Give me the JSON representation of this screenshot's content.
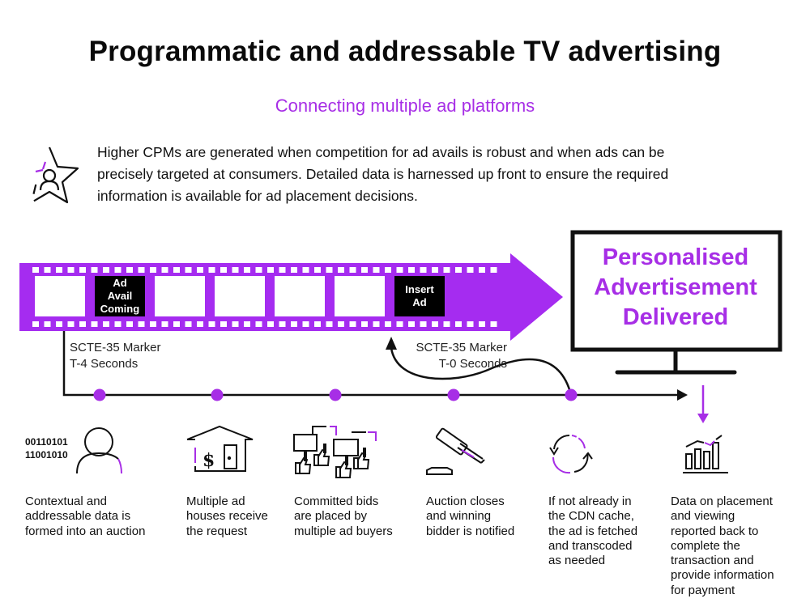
{
  "header": {
    "title": "Programmatic and addressable TV advertising",
    "subtitle": "Connecting multiple ad platforms"
  },
  "intro": {
    "icon": "star-user-icon",
    "text": "Higher CPMs are generated when competition for ad avails is robust and when ads can be precisely targeted at consumers.  Detailed data is harnessed up front to ensure the required information is available for ad placement decisions."
  },
  "filmstrip": {
    "frames": [
      {
        "label": "",
        "type": "blank"
      },
      {
        "label": "Ad\nAvail\nComing",
        "type": "marker"
      },
      {
        "label": "",
        "type": "blank"
      },
      {
        "label": "",
        "type": "blank"
      },
      {
        "label": "",
        "type": "blank"
      },
      {
        "label": "",
        "type": "blank"
      },
      {
        "label": "Insert\nAd",
        "type": "marker"
      }
    ],
    "ad_avail_lines": [
      "Ad",
      "Avail",
      "Coming"
    ],
    "insert_ad_lines": [
      "Insert",
      "Ad"
    ]
  },
  "tv": {
    "lines": [
      "Personalised",
      "Advertisement",
      "Delivered"
    ]
  },
  "markers": {
    "first": {
      "line1": "SCTE-35 Marker",
      "line2": "T-4 Seconds"
    },
    "second": {
      "line1": "SCTE-35 Marker",
      "line2": "T-0 Seconds"
    }
  },
  "binary": {
    "line1": "00110101",
    "line2": "11001010"
  },
  "steps": [
    {
      "icon": "user-data-icon",
      "lines": [
        "Contextual and",
        "addressable data is",
        "formed into an auction"
      ]
    },
    {
      "icon": "ad-house-icon",
      "lines": [
        "Multiple ad",
        "houses receive",
        "the request"
      ]
    },
    {
      "icon": "bidding-paddles-icon",
      "lines": [
        "Committed bids",
        "are placed by",
        "multiple ad buyers"
      ]
    },
    {
      "icon": "gavel-icon",
      "lines": [
        "Auction closes",
        "and winning",
        "bidder is notified"
      ]
    },
    {
      "icon": "refresh-cycle-icon",
      "lines": [
        "If not already in",
        "the CDN cache,",
        "the ad is fetched",
        "and transcoded",
        "as needed"
      ]
    },
    {
      "icon": "bar-chart-report-icon",
      "lines": [
        "Data on placement",
        "and viewing",
        "reported back to",
        "complete the",
        "transaction and",
        "provide information",
        "for payment"
      ]
    }
  ],
  "colors": {
    "accent": "#a72ee6",
    "arrow": "#a52cf0",
    "text": "#111111"
  }
}
